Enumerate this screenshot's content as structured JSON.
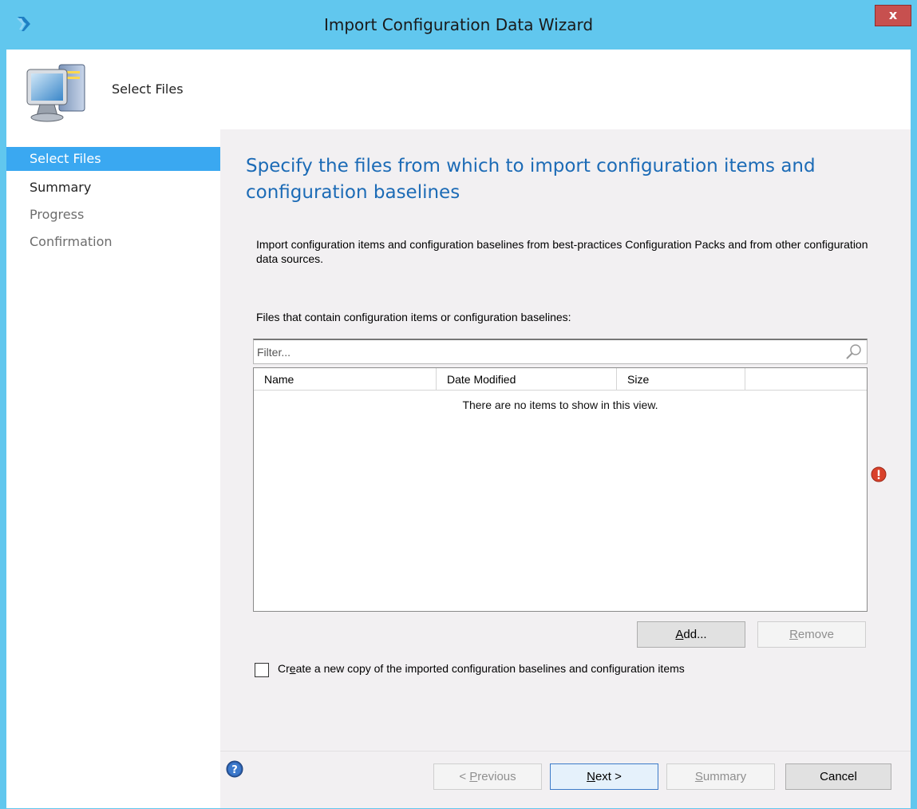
{
  "window": {
    "title": "Import Configuration Data Wizard",
    "close_label": "x",
    "accent_color": "#61c7ee"
  },
  "header": {
    "title": "Select Files",
    "icon": "computer-icon"
  },
  "sidebar": {
    "items": [
      {
        "label": "Select Files",
        "state": "active"
      },
      {
        "label": "Summary",
        "state": "enabled"
      },
      {
        "label": "Progress",
        "state": "disabled"
      },
      {
        "label": "Confirmation",
        "state": "disabled"
      }
    ]
  },
  "main": {
    "heading": "Specify the files from which to import configuration items and configuration baselines",
    "description": "Import configuration items and configuration baselines from best-practices Configuration Packs and from other configuration data sources.",
    "files_label": "Files that contain configuration items or configuration baselines:",
    "filter_placeholder": "Filter...",
    "columns": [
      "Name",
      "Date Modified",
      "Size"
    ],
    "empty_message": "There are no items to show in this view.",
    "add_label": "Add...",
    "remove_label": "Remove",
    "checkbox_label": "Create a new copy of the imported configuration baselines and configuration items",
    "checkbox_checked": false
  },
  "footer": {
    "previous_label": "< Previous",
    "next_label": "Next >",
    "summary_label": "Summary",
    "cancel_label": "Cancel"
  }
}
